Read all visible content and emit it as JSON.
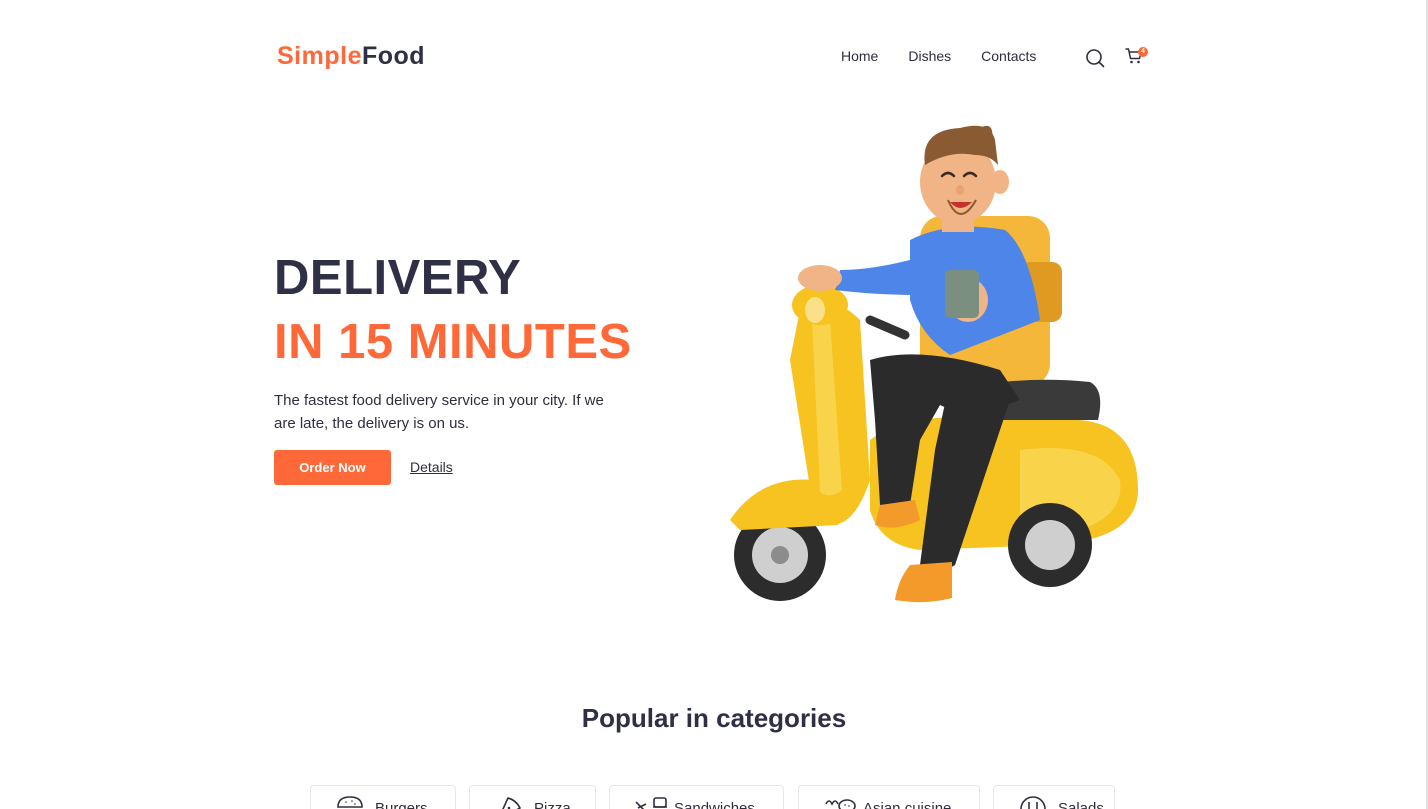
{
  "header": {
    "logo_part1": "Simple",
    "logo_part2": "Food",
    "nav": [
      {
        "label": "Home"
      },
      {
        "label": "Dishes"
      },
      {
        "label": "Contacts"
      }
    ],
    "search_icon": "search-icon",
    "cart_icon": "cart-icon",
    "cart_count": "4"
  },
  "hero": {
    "title_line1": "DELIVERY",
    "title_line2": "IN 15 MINUTES",
    "description": "The fastest food delivery service in your city. If we are late, the delivery is on us.",
    "order_button": "Order Now",
    "details_link": "Details",
    "illustration": "delivery-courier-on-scooter"
  },
  "categories": {
    "title": "Popular in categories",
    "items": [
      {
        "label": "Burgers",
        "icon": "burger-icon"
      },
      {
        "label": "Pizza",
        "icon": "pizza-icon"
      },
      {
        "label": "Sandwiches",
        "icon": "sandwich-icon"
      },
      {
        "label": "Asian cuisine",
        "icon": "asian-cuisine-icon"
      },
      {
        "label": "Salads",
        "icon": "salad-icon"
      }
    ]
  },
  "colors": {
    "accent": "#ff6838",
    "dark": "#2f2f45",
    "text": "#2e2e40"
  }
}
